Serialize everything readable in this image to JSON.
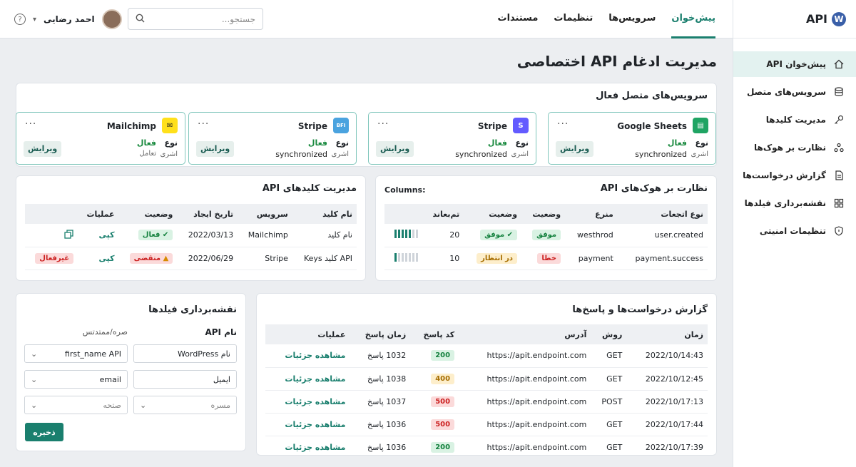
{
  "app": {
    "logo_letter": "W",
    "logo_text": "API"
  },
  "sidebar": {
    "items": [
      {
        "label": "پیش‌خوان API",
        "icon": "home-icon"
      },
      {
        "label": "سرویس‌های متصل",
        "icon": "database-icon"
      },
      {
        "label": "مدیریت کلیدها",
        "icon": "key-icon"
      },
      {
        "label": "نظارت بر هوک‌ها",
        "icon": "webhook-icon"
      },
      {
        "label": "گزارش درخواست‌ها",
        "icon": "document-icon"
      },
      {
        "label": "نقشه‌برداری فیلدها",
        "icon": "grid-icon"
      },
      {
        "label": "تنظیمات امنیتی",
        "icon": "shield-icon"
      }
    ]
  },
  "header": {
    "tabs": [
      "پیش‌خوان",
      "سرویس‌ها",
      "تنظیمات",
      "مستندات"
    ],
    "search_placeholder": "جستجو...",
    "user_name": "احمد رضایی"
  },
  "page_title": "مدیریت ادغام API اختصاصی",
  "services": {
    "title": "سرویس‌های متصل فعال",
    "cards": [
      {
        "name": "Google Sheets",
        "type": "نوع",
        "status": "فعال",
        "sub": "اشری",
        "sync": "synchronized",
        "edit": "ویرایش",
        "color": "#1fa463",
        "glyph": "▤"
      },
      {
        "name": "Stripe",
        "type": "نوع",
        "status": "فعال",
        "sub": "اشری",
        "sync": "synchronized",
        "edit": "ویرایش",
        "color": "#635bff",
        "glyph": "S"
      },
      {
        "name": "Stripe",
        "type": "نوع",
        "status": "فعال",
        "sub": "اشری",
        "sync": "synchronized",
        "edit": "ویرایش",
        "color": "#4aa3df",
        "glyph": "BFI"
      },
      {
        "name": "Mailchimp",
        "type": "نوع",
        "status": "فعال",
        "sub": "اشری",
        "sync": "تعامل",
        "edit": "ویرایش",
        "color": "#ffe01b",
        "glyph": "✉"
      }
    ]
  },
  "webhooks": {
    "title": "نظارت بر هوک‌های API",
    "columns_label": "Columns:",
    "headers": [
      "نوع اتجعات",
      "منرع",
      "وضعیت",
      "وضعیت",
      "تم‌بعاند"
    ],
    "rows": [
      {
        "event": "user.created",
        "source": "westhrod",
        "status1": "موفق",
        "status2": "موفق",
        "count": "20",
        "bars": 5
      },
      {
        "event": "payment.success",
        "source": "payment",
        "status1": "خطا",
        "status2": "در انتظار",
        "count": "10",
        "bars": 1
      }
    ]
  },
  "keys": {
    "title": "مدیریت کلیدهای API",
    "headers": [
      "نام کلید",
      "سرویس",
      "تاریخ ایجاد",
      "وضعیت",
      "عملیات"
    ],
    "rows": [
      {
        "name": "نام کلید",
        "service": "Mailchimp",
        "date": "2022/03/13",
        "status": "فعال",
        "action": "کپی",
        "extra": ""
      },
      {
        "name": "API کلید Keys",
        "service": "Stripe",
        "date": "2022/06/29",
        "status": "منقضی",
        "action": "کپی",
        "extra": "غیرفعال"
      }
    ]
  },
  "requests": {
    "title": "گزارش درخواست‌ها و پاسخ‌ها",
    "headers": [
      "زمان",
      "روش",
      "آدرس",
      "کد پاسخ",
      "زمان پاسخ",
      "عملیات"
    ],
    "rows": [
      {
        "time": "2022/10/14:43",
        "method": "GET",
        "url": "https://apit.endpoint.com",
        "code": "200",
        "resp": "1032 پاسخ",
        "action": "مشاهده جزئیات"
      },
      {
        "time": "2022/10/12:45",
        "method": "GET",
        "url": "https://apit.endpoint.com",
        "code": "400",
        "resp": "1038 پاسخ",
        "action": "مشاهده جزئیات"
      },
      {
        "time": "2022/10/17:13",
        "method": "POST",
        "url": "https://apit.endpoint.com",
        "code": "500",
        "resp": "1037 پاسخ",
        "action": "مشاهده جزئیات"
      },
      {
        "time": "2022/10/17:44",
        "method": "GET",
        "url": "https://apit.endpoint.com",
        "code": "500",
        "resp": "1036 پاسخ",
        "action": "مشاهده جزئیات"
      },
      {
        "time": "2022/10/17:39",
        "method": "GET",
        "url": "https://apit.endpoint.com",
        "code": "200",
        "resp": "1036 پاسخ",
        "action": "مشاهده جزئیات"
      }
    ]
  },
  "mapping": {
    "title": "نقشه‌برداری فیلدها",
    "col_right": "نام API",
    "col_left": "صره/ممتدتس",
    "fields": [
      {
        "right": "نام WordPress",
        "left": "first_name API",
        "left_ph": false
      },
      {
        "right": "ایمیل",
        "left": "email",
        "left_ph": false
      },
      {
        "right": "مسره",
        "left": "صتحه",
        "left_ph": true
      }
    ],
    "save": "ذخیره"
  }
}
